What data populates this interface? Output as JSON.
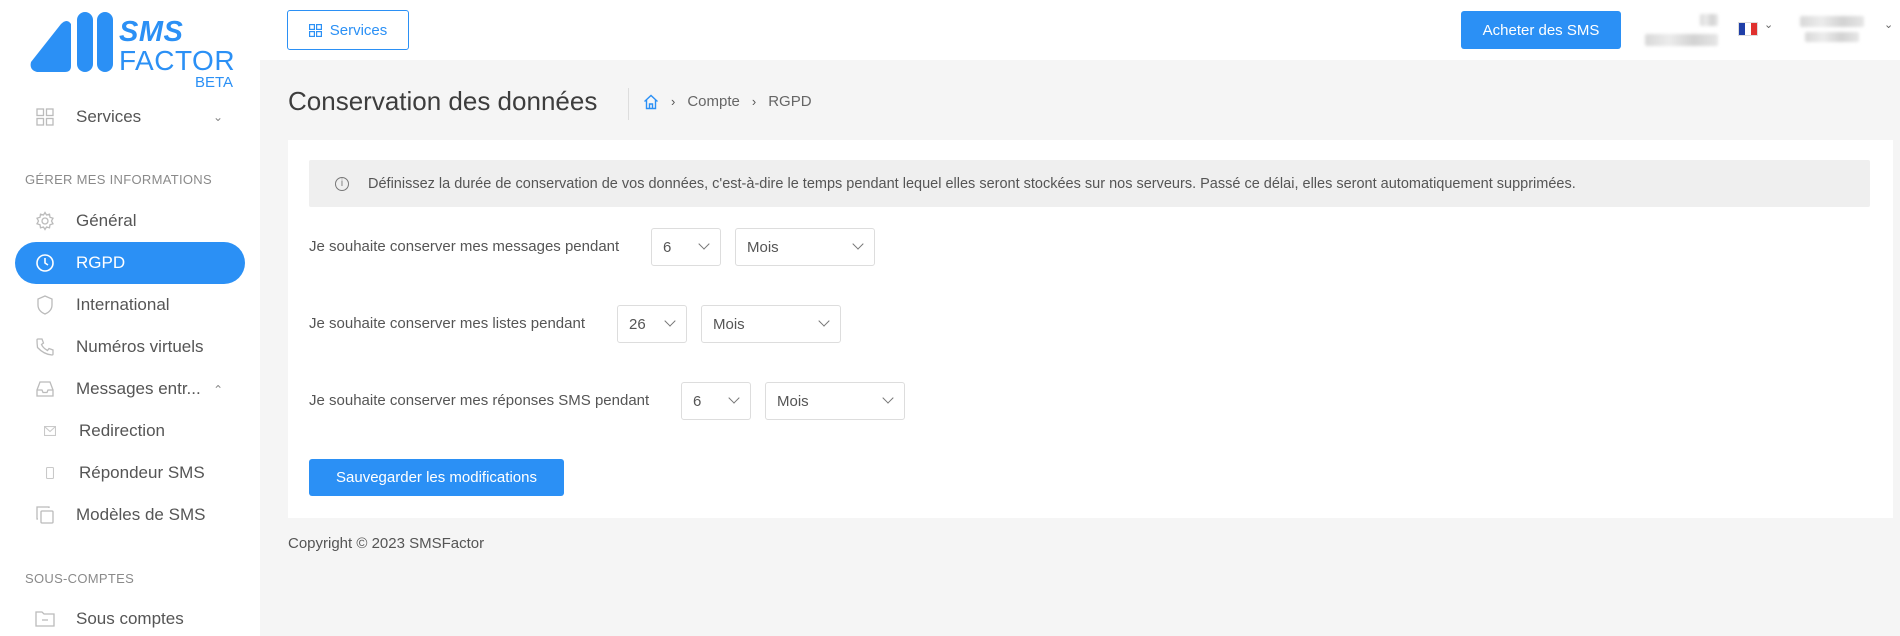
{
  "logo": {
    "line1": "SMS",
    "line2": "FACTOR",
    "line3": "BETA"
  },
  "sidebar": {
    "services_label": "Services",
    "section_manage": "GÉRER MES INFORMATIONS",
    "items": [
      {
        "label": "Général",
        "icon": "gear-icon"
      },
      {
        "label": "RGPD",
        "icon": "clock-icon",
        "active": true
      },
      {
        "label": "International",
        "icon": "shield-icon"
      },
      {
        "label": "Numéros virtuels",
        "icon": "phone-icon"
      },
      {
        "label": "Messages entr...",
        "icon": "inbox-icon"
      },
      {
        "label": "Redirection",
        "icon": "mail-icon"
      },
      {
        "label": "Répondeur SMS",
        "icon": "mobile-icon"
      },
      {
        "label": "Modèles de SMS",
        "icon": "copy-icon"
      }
    ],
    "section_sub": "SOUS-COMPTES",
    "sub_accounts_label": "Sous comptes"
  },
  "topbar": {
    "services_button": "Services",
    "buy_button": "Acheter des SMS",
    "language": "FR"
  },
  "page": {
    "title": "Conservation des données",
    "breadcrumb": [
      "Compte",
      "RGPD"
    ]
  },
  "card": {
    "info_text": "Définissez la durée de conservation de vos données, c'est-à-dire le temps pendant lequel elles seront stockées sur nos serveurs. Passé ce délai, elles seront automatiquement supprimées.",
    "rows": [
      {
        "label": "Je souhaite conserver mes messages pendant",
        "value": "6",
        "unit": "Mois"
      },
      {
        "label": "Je souhaite conserver mes listes pendant",
        "value": "26",
        "unit": "Mois"
      },
      {
        "label": "Je souhaite conserver mes réponses SMS pendant",
        "value": "6",
        "unit": "Mois"
      }
    ],
    "save_button": "Sauvegarder les modifications"
  },
  "footer": {
    "copyright": "Copyright © 2023 SMSFactor"
  },
  "colors": {
    "accent": "#2b90f5",
    "background": "#f5f5f5"
  }
}
